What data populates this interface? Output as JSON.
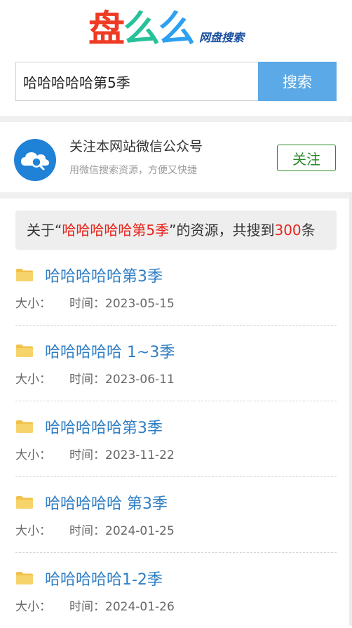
{
  "logo": {
    "chars": [
      {
        "text": "盘",
        "color": "#ef3b24"
      },
      {
        "text": "么",
        "color": "#27c29a"
      },
      {
        "text": "么",
        "color": "#2ea0f0"
      }
    ],
    "subtitle": "网盘搜索"
  },
  "search": {
    "value": "哈哈哈哈哈第5季",
    "button_label": "搜索"
  },
  "follow": {
    "title": "关注本网站微信公众号",
    "description": "用微信搜索资源，方便又快捷",
    "button_label": "关注"
  },
  "summary": {
    "prefix": "关于“",
    "keyword": "哈哈哈哈哈第5季",
    "middle": "”的资源，共搜到",
    "count": "300",
    "suffix": "条"
  },
  "results": [
    {
      "name": "哈哈哈哈哈第3季",
      "size_label": "大小：",
      "time_label": "时间：",
      "time": "2023-05-15"
    },
    {
      "name": "哈哈哈哈哈 1~3季",
      "size_label": "大小：",
      "time_label": "时间：",
      "time": "2023-06-11"
    },
    {
      "name": "哈哈哈哈哈第3季",
      "size_label": "大小：",
      "time_label": "时间：",
      "time": "2023-11-22"
    },
    {
      "name": "哈哈哈哈哈 第3季",
      "size_label": "大小：",
      "time_label": "时间：",
      "time": "2024-01-25"
    },
    {
      "name": "哈哈哈哈哈1-2季",
      "size_label": "大小：",
      "time_label": "时间：",
      "time": "2024-01-26"
    }
  ],
  "colors": {
    "accent": "#5ba9e6",
    "link": "#2f7ec4",
    "highlight": "#e8221a",
    "follow_green": "#2a8a2a"
  }
}
